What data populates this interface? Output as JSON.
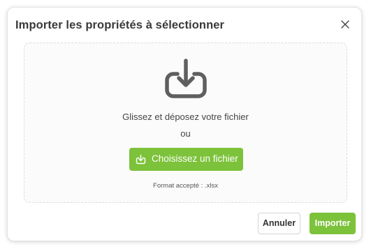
{
  "dialog": {
    "title": "Importer les propriétés à sélectionner",
    "close_icon": "close-icon"
  },
  "dropzone": {
    "icon": "download-tray-icon",
    "instruction": "Glissez et déposez votre fichier",
    "or_text": "ou",
    "choose_button": {
      "label": "Choisissez un fichier",
      "icon": "download-tray-icon"
    },
    "format_note": "Format accepté : .xlsx"
  },
  "footer": {
    "cancel_label": "Annuler",
    "import_label": "Importer"
  },
  "colors": {
    "accent_green": "#7cc23a",
    "title_text": "#3a3a3a",
    "icon_gray": "#5f5f5f"
  }
}
